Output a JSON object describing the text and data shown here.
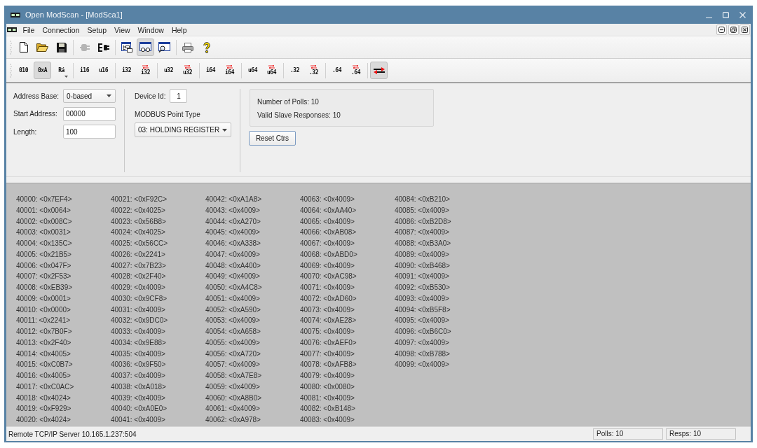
{
  "window": {
    "title": "Open ModScan - [ModSca1]"
  },
  "menu_bar": {
    "items": [
      "File",
      "Connection",
      "Setup",
      "View",
      "Window",
      "Help"
    ]
  },
  "toolbar": {
    "groups": [
      {
        "buttons": [
          {
            "selected": false,
            "disabled": false
          },
          {
            "selected": false,
            "disabled": false
          },
          {
            "selected": false,
            "disabled": false
          }
        ]
      },
      {
        "buttons": [
          {
            "selected": false,
            "disabled": true
          },
          {
            "selected": false,
            "disabled": false
          }
        ]
      },
      {
        "buttons": [
          {
            "selected": false,
            "disabled": false
          },
          {
            "selected": true,
            "disabled": false
          },
          {
            "selected": false,
            "disabled": false
          }
        ]
      },
      {
        "buttons": [
          {
            "selected": false,
            "disabled": false
          },
          {
            "selected": false,
            "disabled": false
          }
        ]
      }
    ]
  },
  "format_toolbar": {
    "groups": [
      {
        "buttons": [
          {
            "kind": "plain",
            "label": "010",
            "selected": false
          },
          {
            "kind": "plain",
            "label": "0xA",
            "selected": true
          },
          {
            "kind": "dropdown",
            "label": "Rá",
            "selected": false
          }
        ]
      },
      {
        "buttons": [
          {
            "kind": "plain",
            "label": "i16",
            "selected": false
          },
          {
            "kind": "plain",
            "label": "u16",
            "selected": false
          }
        ]
      },
      {
        "buttons": [
          {
            "kind": "plain",
            "label": "i32",
            "selected": false
          },
          {
            "kind": "swapped",
            "label": "i32",
            "selected": false
          }
        ]
      },
      {
        "buttons": [
          {
            "kind": "plain",
            "label": "u32",
            "selected": false
          },
          {
            "kind": "swapped",
            "label": "u32",
            "selected": false
          }
        ]
      },
      {
        "buttons": [
          {
            "kind": "plain",
            "label": "i64",
            "selected": false
          },
          {
            "kind": "swapped",
            "label": "i64",
            "selected": false
          }
        ]
      },
      {
        "buttons": [
          {
            "kind": "plain",
            "label": "u64",
            "selected": false
          },
          {
            "kind": "swapped",
            "label": "u64",
            "selected": false
          }
        ]
      },
      {
        "buttons": [
          {
            "kind": "plain",
            "label": ".32",
            "selected": false
          },
          {
            "kind": "swapped",
            "label": ".32",
            "selected": false
          }
        ]
      },
      {
        "buttons": [
          {
            "kind": "plain",
            "label": ".64",
            "selected": false
          },
          {
            "kind": "swapped",
            "label": ".64",
            "selected": false
          }
        ]
      },
      {
        "buttons": [
          {
            "kind": "icon",
            "selected": true
          }
        ]
      }
    ]
  },
  "settings": {
    "fields": [
      {
        "kind": "dropdown",
        "label": "Address Base:",
        "value": "0-based"
      },
      {
        "kind": "input",
        "label": "Start Address:",
        "value": "00000"
      },
      {
        "kind": "input",
        "label": "Length:",
        "value": "100"
      }
    ],
    "device_id": {
      "kind": "input",
      "label": "Device Id:",
      "value": "1"
    },
    "point_type": {
      "kind": "dropdown",
      "label": "MODBUS Point Type",
      "value": "03: HOLDING REGISTER"
    },
    "counters": [
      "Number of Polls: 10",
      "Valid Slave Responses: 10"
    ],
    "reset_button": {
      "label": "Reset Ctrs"
    }
  },
  "data_view": {
    "cells": [
      "40000: <0x7EF4>",
      "40001: <0x0064>",
      "40002: <0x008C>",
      "40003: <0x0031>",
      "40004: <0x135C>",
      "40005: <0x21B5>",
      "40006: <0x047F>",
      "40007: <0x2F53>",
      "40008: <0xEB39>",
      "40009: <0x0001>",
      "40010: <0x0000>",
      "40011: <0x2241>",
      "40012: <0x7B0F>",
      "40013: <0x2F40>",
      "40014: <0x4005>",
      "40015: <0xC0B7>",
      "40016: <0x4005>",
      "40017: <0xC0AC>",
      "40018: <0x4024>",
      "40019: <0xF929>",
      "40020: <0x4024>",
      "40021: <0xF92C>",
      "40022: <0x4025>",
      "40023: <0x56B8>",
      "40024: <0x4025>",
      "40025: <0x56CC>",
      "40026: <0x2241>",
      "40027: <0x7B23>",
      "40028: <0x2F40>",
      "40029: <0x4009>",
      "40030: <0x9CF8>",
      "40031: <0x4009>",
      "40032: <0x9DC0>",
      "40033: <0x4009>",
      "40034: <0x9E88>",
      "40035: <0x4009>",
      "40036: <0x9F50>",
      "40037: <0x4009>",
      "40038: <0xA018>",
      "40039: <0x4009>",
      "40040: <0xA0E0>",
      "40041: <0x4009>",
      "40042: <0xA1A8>",
      "40043: <0x4009>",
      "40044: <0xA270>",
      "40045: <0x4009>",
      "40046: <0xA338>",
      "40047: <0x4009>",
      "40048: <0xA400>",
      "40049: <0x4009>",
      "40050: <0xA4C8>",
      "40051: <0x4009>",
      "40052: <0xA590>",
      "40053: <0x4009>",
      "40054: <0xA658>",
      "40055: <0x4009>",
      "40056: <0xA720>",
      "40057: <0x4009>",
      "40058: <0xA7E8>",
      "40059: <0x4009>",
      "40060: <0xA8B0>",
      "40061: <0x4009>",
      "40062: <0xA978>",
      "40063: <0x4009>",
      "40064: <0xAA40>",
      "40065: <0x4009>",
      "40066: <0xAB08>",
      "40067: <0x4009>",
      "40068: <0xABD0>",
      "40069: <0x4009>",
      "40070: <0xAC98>",
      "40071: <0x4009>",
      "40072: <0xAD60>",
      "40073: <0x4009>",
      "40074: <0xAE28>",
      "40075: <0x4009>",
      "40076: <0xAEF0>",
      "40077: <0x4009>",
      "40078: <0xAFB8>",
      "40079: <0x4009>",
      "40080: <0x0080>",
      "40081: <0x4009>",
      "40082: <0xB148>",
      "40083: <0x4009>",
      "40084: <0xB210>",
      "40085: <0x4009>",
      "40086: <0xB2D8>",
      "40087: <0x4009>",
      "40088: <0xB3A0>",
      "40089: <0x4009>",
      "40090: <0xB468>",
      "40091: <0x4009>",
      "40092: <0xB530>",
      "40093: <0x4009>",
      "40094: <0xB5F8>",
      "40095: <0x4009>",
      "40096: <0xB6C0>",
      "40097: <0x4009>",
      "40098: <0xB788>",
      "40099: <0x4009>"
    ]
  },
  "status_bar": {
    "message": "Remote TCP/IP Server 10.165.1.237:504",
    "panels": [
      "Polls: 10",
      "Resps: 10"
    ]
  }
}
